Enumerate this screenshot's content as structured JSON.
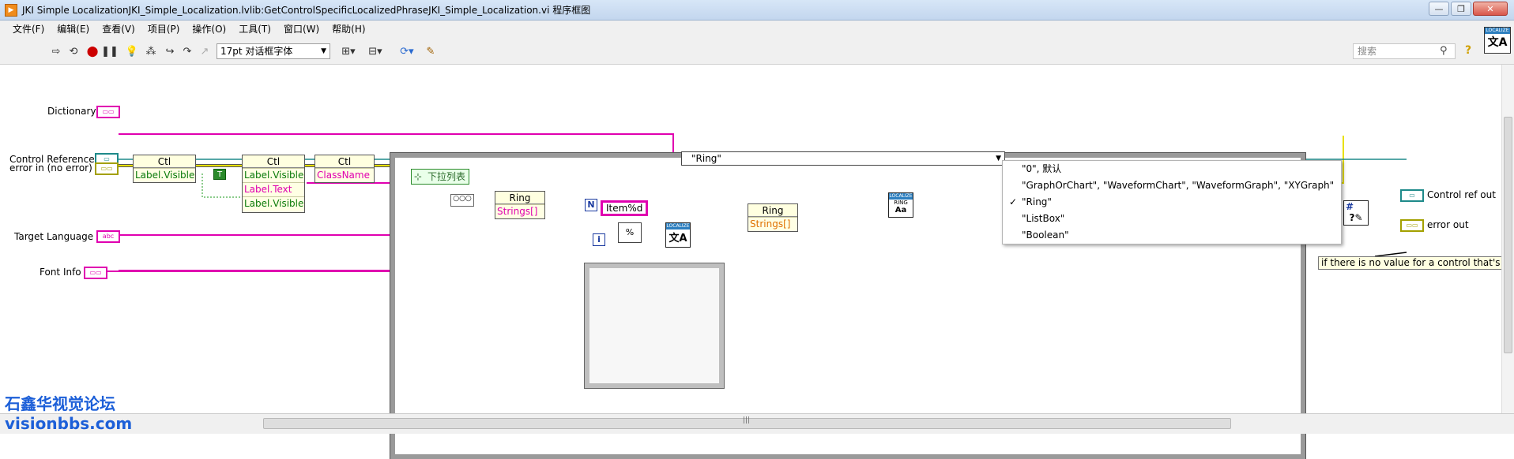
{
  "window": {
    "title": "JKI Simple LocalizationJKI_Simple_Localization.lvlib:GetControlSpecificLocalizedPhraseJKI_Simple_Localization.vi 程序框图",
    "app_icon": "labview-vi-icon",
    "buttons": {
      "minimize": "—",
      "restore": "❐",
      "close": "✕"
    }
  },
  "menu": [
    "文件(F)",
    "编辑(E)",
    "查看(V)",
    "项目(P)",
    "操作(O)",
    "工具(T)",
    "窗口(W)",
    "帮助(H)"
  ],
  "toolbar": {
    "font_select": "17pt 对话框字体",
    "search_placeholder": "搜索"
  },
  "badge": {
    "header": "LOCALIZE"
  },
  "diagram": {
    "inputs": {
      "dictionary": "Dictionary",
      "control_reference": "Control Reference",
      "error_in": "error in (no error)",
      "target_language": "Target Language",
      "font_info": "Font Info"
    },
    "outputs": {
      "control_ref_out": "Control ref out",
      "error_out": "error out"
    },
    "property_nodes": [
      {
        "header": "Ctl",
        "rows": [
          "Label.Visible"
        ]
      },
      {
        "header": "Ctl",
        "rows": [
          "Label.Visible",
          "Label.Text",
          "Label.Visible"
        ]
      },
      {
        "header": "Ctl",
        "rows": [
          "ClassName"
        ]
      },
      {
        "header": "Ring",
        "rows": [
          "Strings[]"
        ]
      },
      {
        "header": "Ring",
        "rows": [
          "Strings[]"
        ]
      }
    ],
    "true_constant": "T",
    "enum_constant": "下拉列表",
    "case_selector": "\"Ring\"",
    "case_options": [
      {
        "label": "\"0\", 默认",
        "checked": false
      },
      {
        "label": "\"GraphOrChart\", \"WaveformChart\", \"WaveformGraph\", \"XYGraph\"",
        "checked": false
      },
      {
        "label": "\"Ring\"",
        "checked": true
      },
      {
        "label": "\"ListBox\"",
        "checked": false
      },
      {
        "label": "\"Boolean\"",
        "checked": false
      }
    ],
    "loop": {
      "count_label": "N",
      "index_label": "i",
      "format_string": "Item%d",
      "format_glyph": "%"
    },
    "localize_icon": {
      "header": "LOCALIZE",
      "glyph": "文A"
    },
    "ring_localize_icon": {
      "header": "LOCALIZE",
      "sub": "RING",
      "glyph": "Aa"
    },
    "comment": "if there is no value for a control that's c"
  },
  "watermark": {
    "line1": "石鑫华视觉论坛",
    "line2": "visionbbs.com"
  },
  "scrollbar_grip": "|||"
}
